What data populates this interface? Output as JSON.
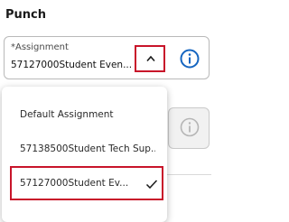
{
  "section": {
    "title": "Punch"
  },
  "assignment_field": {
    "label": "*Assignment",
    "value": "57127000Student Even..."
  },
  "icons": {
    "toggle": "chevron-up-icon",
    "info": "info-icon",
    "selected": "check-icon"
  },
  "dropdown": {
    "options": [
      {
        "label": "Default Assignment",
        "selected": false
      },
      {
        "label": "57138500Student Tech Sup...",
        "selected": false
      },
      {
        "label": "57127000Student Ev...",
        "selected": true
      }
    ]
  },
  "colors": {
    "highlight": "#c8142a",
    "info": "#1565c0",
    "disabled_info": "#b5b5b5"
  }
}
